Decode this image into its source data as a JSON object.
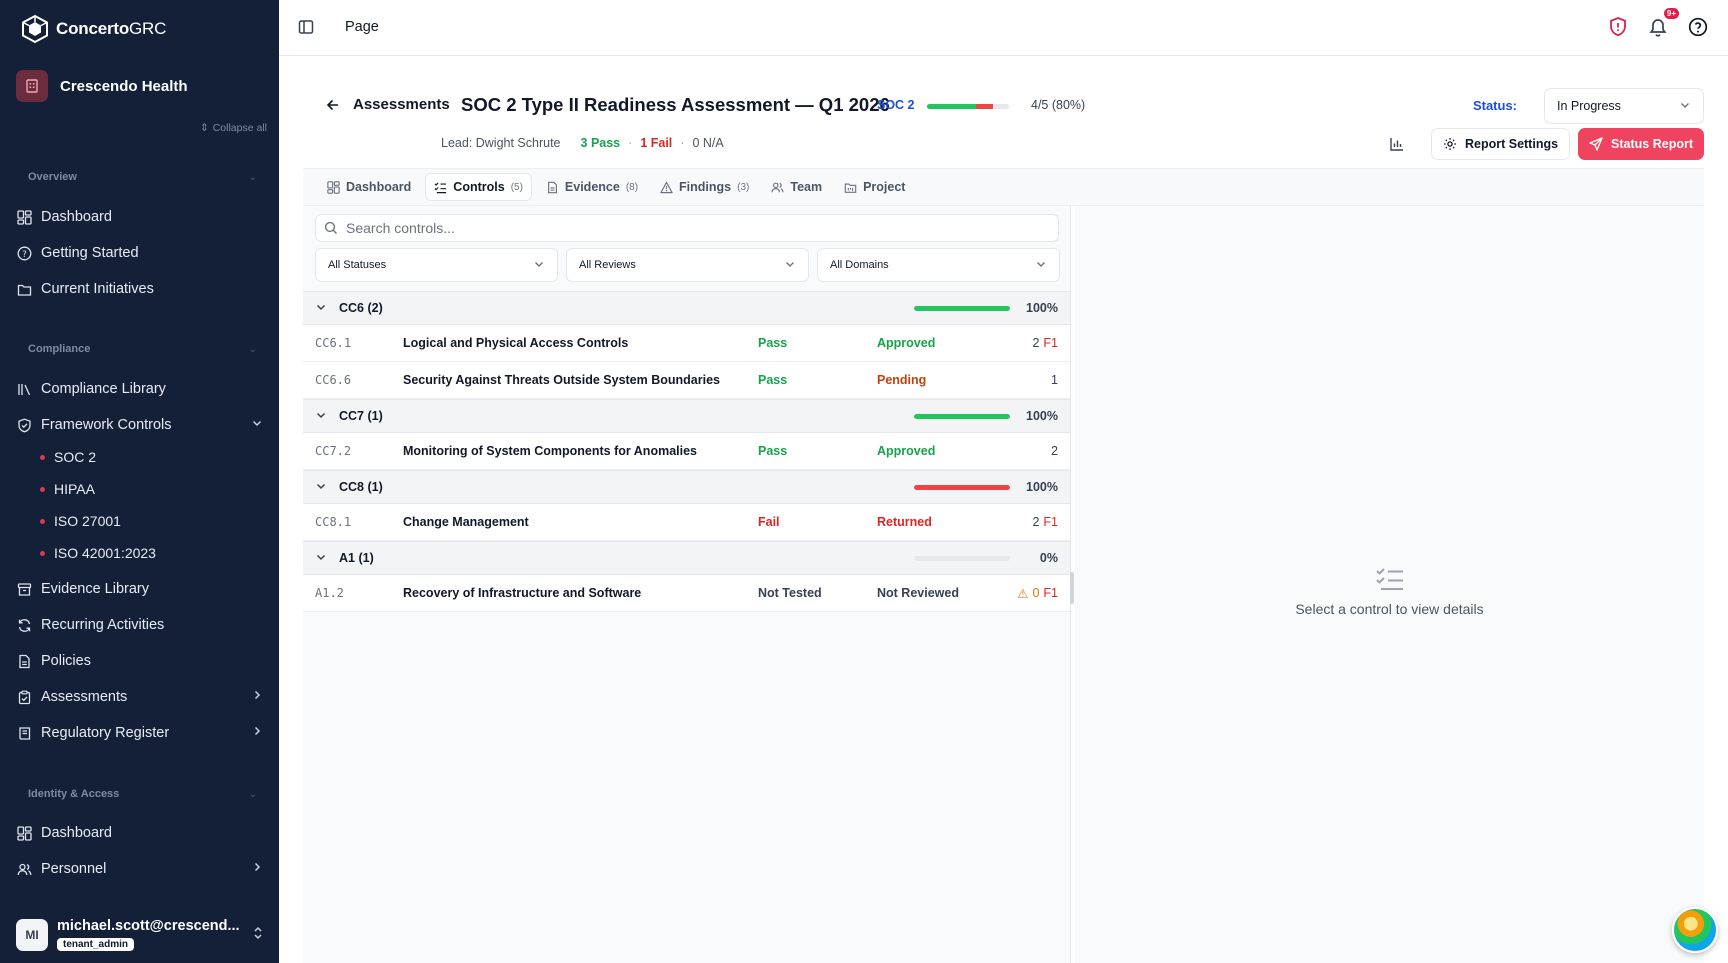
{
  "brand": {
    "name_bold": "Concerto",
    "name_light": "GRC"
  },
  "org": {
    "name": "Crescendo Health"
  },
  "sidebar": {
    "collapse_all": "Collapse all",
    "sections": [
      {
        "label": "Overview"
      },
      {
        "label": "Compliance"
      },
      {
        "label": "Identity & Access"
      }
    ],
    "items": [
      {
        "label": "Dashboard",
        "icon": "dashboard-icon"
      },
      {
        "label": "Getting Started",
        "icon": "help-circle-icon"
      },
      {
        "label": "Current Initiatives",
        "icon": "folder-icon"
      },
      {
        "label": "Compliance Library",
        "icon": "library-icon"
      },
      {
        "label": "Framework Controls",
        "icon": "shield-check-icon",
        "expanded": true
      },
      {
        "label": "Evidence Library",
        "icon": "archive-icon"
      },
      {
        "label": "Recurring Activities",
        "icon": "refresh-icon"
      },
      {
        "label": "Policies",
        "icon": "file-icon"
      },
      {
        "label": "Assessments",
        "icon": "clipboard-check-icon"
      },
      {
        "label": "Regulatory Register",
        "icon": "book-icon"
      },
      {
        "label": "Dashboard",
        "icon": "dashboard-icon"
      },
      {
        "label": "Personnel",
        "icon": "users-icon"
      }
    ],
    "frameworks": [
      "SOC 2",
      "HIPAA",
      "ISO 27001",
      "ISO 42001:2023"
    ],
    "user": {
      "initials": "MI",
      "email": "michael.scott@crescend...",
      "role": "tenant_admin"
    }
  },
  "topbar": {
    "page": "Page",
    "notification_badge": "9+"
  },
  "assessment": {
    "breadcrumb": "Assessments",
    "title": "SOC 2 Type II Readiness Assessment — Q1 2026",
    "framework": "SOC 2",
    "progress_text": "4/5 (80%)",
    "progress": {
      "pass_fraction": 0.6,
      "fail_fraction": 0.2
    },
    "lead": "Lead: Dwight Schrute",
    "pass": "3 Pass",
    "fail": "1 Fail",
    "na": "0 N/A",
    "status_label": "Status:",
    "status_value": "In Progress",
    "report_settings": "Report Settings",
    "status_report": "Status Report"
  },
  "tabs": [
    {
      "label": "Dashboard",
      "count": ""
    },
    {
      "label": "Controls",
      "count": "(5)"
    },
    {
      "label": "Evidence",
      "count": "(8)"
    },
    {
      "label": "Findings",
      "count": "(3)"
    },
    {
      "label": "Team",
      "count": ""
    },
    {
      "label": "Project",
      "count": ""
    }
  ],
  "controls": {
    "search_placeholder": "Search controls...",
    "filters": [
      "All Statuses",
      "All Reviews",
      "All Domains"
    ],
    "groups": [
      {
        "label": "CC6 (2)",
        "pct": "100%",
        "fill": 1.0,
        "color": "#22c55e",
        "rows": [
          {
            "id": "CC6.1",
            "name": "Logical and Physical Access Controls",
            "test": "Pass",
            "review": "Approved",
            "evidence": "2",
            "findings": "F1"
          },
          {
            "id": "CC6.6",
            "name": "Security Against Threats Outside System Boundaries",
            "test": "Pass",
            "review": "Pending",
            "evidence": "1",
            "findings": ""
          }
        ]
      },
      {
        "label": "CC7 (1)",
        "pct": "100%",
        "fill": 1.0,
        "color": "#22c55e",
        "rows": [
          {
            "id": "CC7.2",
            "name": "Monitoring of System Components for Anomalies",
            "test": "Pass",
            "review": "Approved",
            "evidence": "2",
            "findings": ""
          }
        ]
      },
      {
        "label": "CC8 (1)",
        "pct": "100%",
        "fill": 1.0,
        "color": "#ef4444",
        "rows": [
          {
            "id": "CC8.1",
            "name": "Change Management",
            "test": "Fail",
            "review": "Returned",
            "evidence": "2",
            "findings": "F1"
          }
        ]
      },
      {
        "label": "A1 (1)",
        "pct": "0%",
        "fill": 0.0,
        "color": "#e5e7eb",
        "rows": [
          {
            "id": "A1.2",
            "name": "Recovery of Infrastructure and Software",
            "test": "Not Tested",
            "review": "Not Reviewed",
            "evidence": "0",
            "findings": "F1",
            "warning": true
          }
        ]
      }
    ]
  },
  "detail": {
    "empty_message": "Select a control to view details"
  }
}
